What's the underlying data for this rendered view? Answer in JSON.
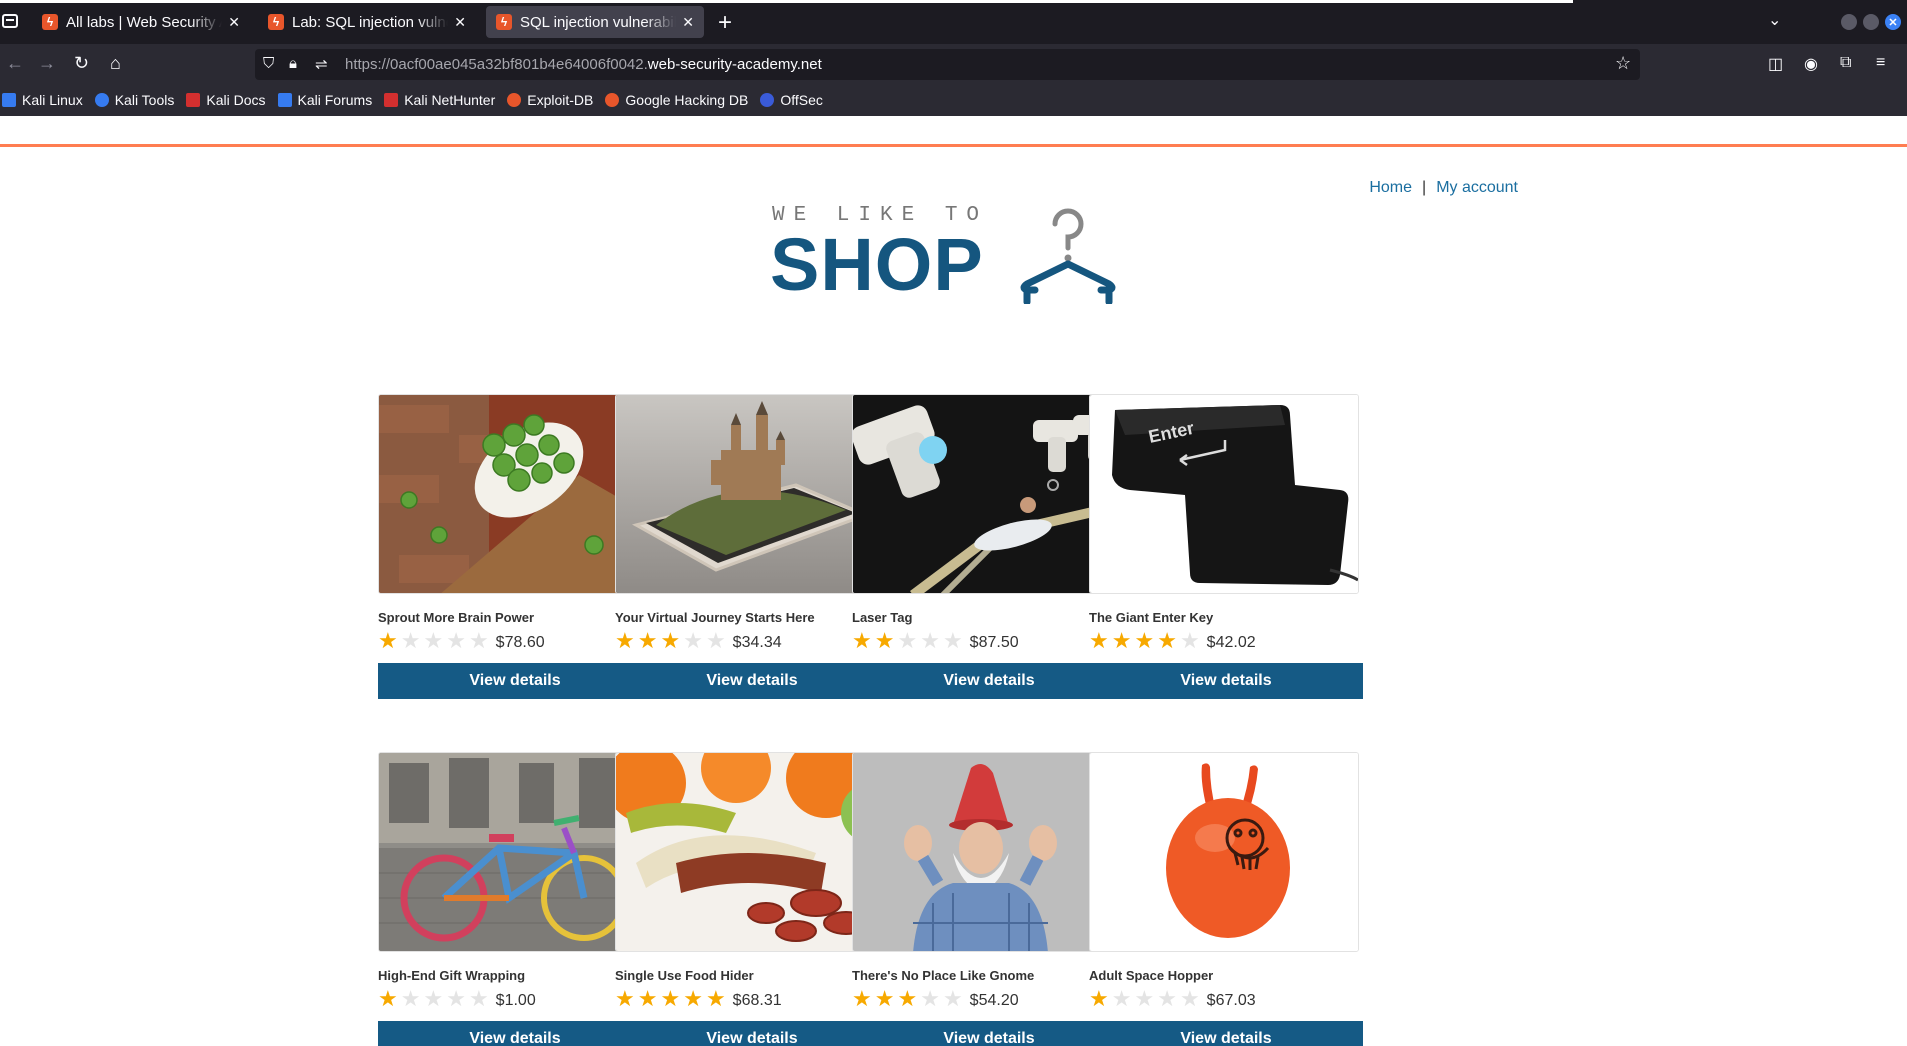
{
  "browser": {
    "tabs": [
      {
        "title": "All labs | Web Security Academy",
        "active": false
      },
      {
        "title": "Lab: SQL injection vulnerability",
        "active": false
      },
      {
        "title": "SQL injection vulnerability",
        "active": true
      }
    ],
    "url_prefix": "https://0acf00ae045a32bf801b4e64006f0042.",
    "url_domain": "web-security-academy.net",
    "bookmarks": [
      {
        "label": "Kali Linux",
        "icon": "kali-icon",
        "color": "#367bf0"
      },
      {
        "label": "Kali Tools",
        "icon": "kali-tools-icon",
        "color": "#367bf0"
      },
      {
        "label": "Kali Docs",
        "icon": "kali-docs-icon",
        "color": "#d32f2f"
      },
      {
        "label": "Kali Forums",
        "icon": "kali-forums-icon",
        "color": "#367bf0"
      },
      {
        "label": "Kali NetHunter",
        "icon": "nethunter-icon",
        "color": "#d32f2f"
      },
      {
        "label": "Exploit-DB",
        "icon": "exploit-db-icon",
        "color": "#e8562b"
      },
      {
        "label": "Google Hacking DB",
        "icon": "ghdb-icon",
        "color": "#e8562b"
      },
      {
        "label": "OffSec",
        "icon": "offsec-icon",
        "color": "#3a5bd9"
      }
    ]
  },
  "site": {
    "nav": {
      "home": "Home",
      "separator": "|",
      "account": "My account"
    },
    "logo": {
      "small": "WE LIKE TO",
      "big": "SHOP"
    },
    "accent_color": "#155a85",
    "star_color": "#f7a900"
  },
  "products": [
    {
      "name": "Sprout More Brain Power",
      "price": "$78.60",
      "rating": 1,
      "button": "View details",
      "image": "brussels-sprouts"
    },
    {
      "name": "Your Virtual Journey Starts Here",
      "price": "$34.34",
      "rating": 3,
      "button": "View details",
      "image": "castle-phone"
    },
    {
      "name": "Laser Tag",
      "price": "$87.50",
      "rating": 2,
      "button": "View details",
      "image": "laser-guns"
    },
    {
      "name": "The Giant Enter Key",
      "price": "$42.02",
      "rating": 4,
      "button": "View details",
      "image": "enter-key"
    },
    {
      "name": "High-End Gift Wrapping",
      "price": "$1.00",
      "rating": 1,
      "button": "View details",
      "image": "knitted-bike"
    },
    {
      "name": "Single Use Food Hider",
      "price": "$68.31",
      "rating": 5,
      "button": "View details",
      "image": "banana-sausage"
    },
    {
      "name": "There's No Place Like Gnome",
      "price": "$54.20",
      "rating": 3,
      "button": "View details",
      "image": "gnome-man"
    },
    {
      "name": "Adult Space Hopper",
      "price": "$67.03",
      "rating": 1,
      "button": "View details",
      "image": "space-hopper"
    }
  ]
}
